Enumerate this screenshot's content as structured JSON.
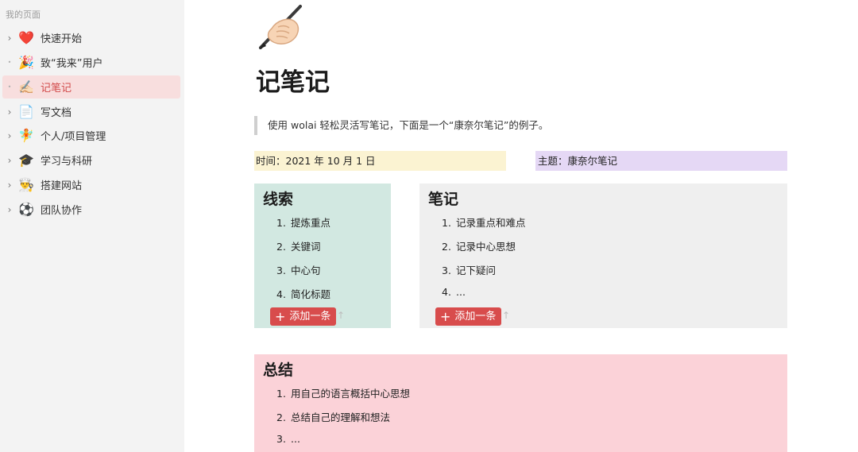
{
  "sidebar": {
    "title": "我的页面",
    "items": [
      {
        "label": "快速开始",
        "emoji": "❤️",
        "caret": "›",
        "active": false
      },
      {
        "label": "致“我来”用户",
        "emoji": "🎉",
        "caret": "•",
        "active": false
      },
      {
        "label": "记笔记",
        "emoji": "✍🏻",
        "caret": "•",
        "active": true
      },
      {
        "label": "写文档",
        "emoji": "📄",
        "caret": "›",
        "active": false
      },
      {
        "label": "个人/项目管理",
        "emoji": "🧚",
        "caret": "›",
        "active": false
      },
      {
        "label": "学习与科研",
        "emoji": "🎓",
        "caret": "›",
        "active": false
      },
      {
        "label": "搭建网站",
        "emoji": "👨‍🍳",
        "caret": "›",
        "active": false
      },
      {
        "label": "团队协作",
        "emoji": "⚽",
        "caret": "›",
        "active": false
      }
    ]
  },
  "page": {
    "icon": "writing-hand-icon",
    "title": "记笔记",
    "quote": "使用 wolai 轻松灵活写笔记，下面是一个“康奈尔笔记”的例子。",
    "time": "时间：2021 年 10 月 1 日",
    "topic": "主题：康奈尔笔记"
  },
  "clues": {
    "title": "线索",
    "items": [
      {
        "num": "1.",
        "text": "提炼重点"
      },
      {
        "num": "2.",
        "text": "关键词"
      },
      {
        "num": "3.",
        "text": "中心句"
      },
      {
        "num": "4.",
        "text": "简化标题"
      }
    ],
    "add_label": "添加一条"
  },
  "notes": {
    "title": "笔记",
    "items": [
      {
        "num": "1.",
        "text": "记录重点和难点"
      },
      {
        "num": "2.",
        "text": "记录中心思想"
      },
      {
        "num": "3.",
        "text": "记下疑问"
      },
      {
        "num": "4.",
        "text": "..."
      }
    ],
    "add_label": "添加一条"
  },
  "summary": {
    "title": "总结",
    "items": [
      {
        "num": "1.",
        "text": "用自己的语言概括中心思想"
      },
      {
        "num": "2.",
        "text": "总结自己的理解和想法"
      },
      {
        "num": "3.",
        "text": "..."
      }
    ]
  },
  "colors": {
    "sidebar_bg": "#f3f3f3",
    "active_bg": "#f8dede",
    "active_text": "#d24b4b",
    "time_bg": "#fbf3d2",
    "topic_bg": "#e5d8f5",
    "clues_bg": "#d2e8e1",
    "notes_bg": "#efefef",
    "summary_bg": "#fbd2d8",
    "add_button": "#d84c4c"
  }
}
